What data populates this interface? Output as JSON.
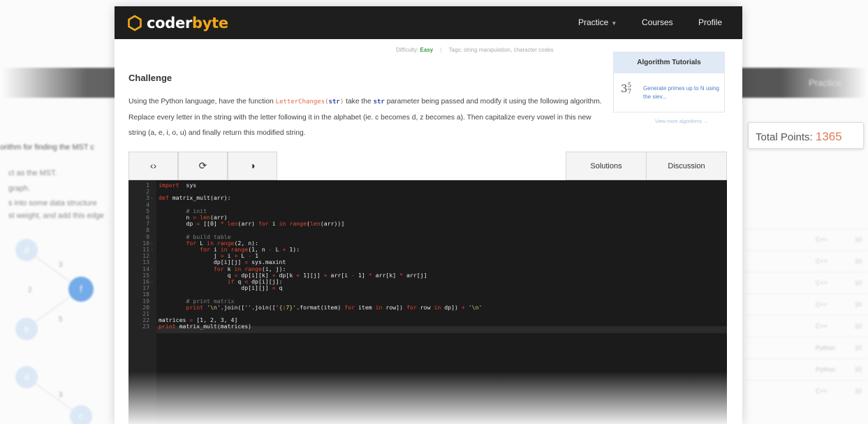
{
  "app": {
    "brand_prefix": "coder",
    "brand_suffix": "byte",
    "accent_color": "#f2a81d"
  },
  "nav": {
    "practice": "Practice",
    "courses": "Courses",
    "profile": "Profile"
  },
  "meta": {
    "difficulty_label": "Difficulty:",
    "difficulty_value": "Easy",
    "tags_label": "Tags:",
    "tags_value": "string manipulation, character codes"
  },
  "challenge": {
    "title": "Challenge",
    "text_1": "Using the Python language, have the function ",
    "function_name": "LetterChanges",
    "function_open": "(",
    "function_arg": "str",
    "function_close": ")",
    "text_2": " take the ",
    "param": "str",
    "text_3": " parameter being passed and modify it using the following algorithm. Replace every letter in the string with the letter following it in the alphabet (ie. c becomes d, z becomes a). Then capitalize every vowel in this new string (a, e, i, o, u) and finally return this modified string."
  },
  "tutorials": {
    "heading": "Algorithm Tutorials",
    "icon_text": "3",
    "icon_num": "5",
    "icon_den": "7",
    "link": "Generate primes up to N using the siev...",
    "view_more": "View more algorithms →"
  },
  "editor_toolbar": {
    "icons": [
      "code-icon",
      "refresh-icon",
      "contrast-icon"
    ],
    "glyphs": [
      "‹›",
      "⟳",
      "◑"
    ]
  },
  "editor_tabs": {
    "solutions": "Solutions",
    "discussion": "Discussion"
  },
  "code": [
    {
      "n": "1",
      "f": "",
      "t": [
        [
          "kw",
          "import"
        ],
        [
          "",
          "  sys"
        ]
      ]
    },
    {
      "n": "2",
      "f": "",
      "t": []
    },
    {
      "n": "3",
      "f": "-",
      "t": [
        [
          "kw",
          "def"
        ],
        [
          "",
          " matrix_mult(arr):"
        ]
      ]
    },
    {
      "n": "4",
      "f": "",
      "t": []
    },
    {
      "n": "5",
      "f": "",
      "t": [
        [
          "",
          "        "
        ],
        [
          "cm",
          "# init"
        ]
      ]
    },
    {
      "n": "6",
      "f": "",
      "t": [
        [
          "",
          "        n "
        ],
        [
          "kw",
          "="
        ],
        [
          "",
          " "
        ],
        [
          "kw",
          "len"
        ],
        [
          "",
          "(arr)"
        ]
      ]
    },
    {
      "n": "7",
      "f": "",
      "t": [
        [
          "",
          "        dp "
        ],
        [
          "kw",
          "="
        ],
        [
          "",
          " [[0] "
        ],
        [
          "kw",
          "*"
        ],
        [
          "",
          " "
        ],
        [
          "kw",
          "len"
        ],
        [
          "",
          "(arr) "
        ],
        [
          "kw",
          "for"
        ],
        [
          "",
          " i "
        ],
        [
          "kw",
          "in"
        ],
        [
          "",
          " "
        ],
        [
          "kw",
          "range"
        ],
        [
          "",
          "("
        ],
        [
          "kw",
          "len"
        ],
        [
          "",
          "(arr))]"
        ]
      ]
    },
    {
      "n": "8",
      "f": "",
      "t": []
    },
    {
      "n": "9",
      "f": "",
      "t": [
        [
          "",
          "        "
        ],
        [
          "cm",
          "# build table"
        ]
      ]
    },
    {
      "n": "10",
      "f": "-",
      "t": [
        [
          "",
          "        "
        ],
        [
          "kw",
          "for"
        ],
        [
          "",
          " L "
        ],
        [
          "kw",
          "in"
        ],
        [
          "",
          " "
        ],
        [
          "kw",
          "range"
        ],
        [
          "",
          "(2, n):"
        ]
      ]
    },
    {
      "n": "11",
      "f": "-",
      "t": [
        [
          "",
          "            "
        ],
        [
          "kw",
          "for"
        ],
        [
          "",
          " i "
        ],
        [
          "kw",
          "in"
        ],
        [
          "",
          " "
        ],
        [
          "kw",
          "range"
        ],
        [
          "",
          "(1, n "
        ],
        [
          "kw",
          "-"
        ],
        [
          "",
          " L "
        ],
        [
          "kw",
          "+"
        ],
        [
          "",
          " 1):"
        ]
      ]
    },
    {
      "n": "12",
      "f": "",
      "t": [
        [
          "",
          "                j "
        ],
        [
          "kw",
          "="
        ],
        [
          "",
          " i "
        ],
        [
          "kw",
          "+"
        ],
        [
          "",
          " L "
        ],
        [
          "kw",
          "-"
        ],
        [
          "",
          " 1"
        ]
      ]
    },
    {
      "n": "13",
      "f": "",
      "t": [
        [
          "",
          "                dp[i][j] "
        ],
        [
          "kw",
          "="
        ],
        [
          "",
          " sys.maxint"
        ]
      ]
    },
    {
      "n": "14",
      "f": "-",
      "t": [
        [
          "",
          "                "
        ],
        [
          "kw",
          "for"
        ],
        [
          "",
          " k "
        ],
        [
          "kw",
          "in"
        ],
        [
          "",
          " "
        ],
        [
          "kw",
          "range"
        ],
        [
          "",
          "(i, j):"
        ]
      ]
    },
    {
      "n": "15",
      "f": "",
      "t": [
        [
          "",
          "                    q "
        ],
        [
          "kw",
          "="
        ],
        [
          "",
          " dp[i][k] "
        ],
        [
          "kw",
          "+"
        ],
        [
          "",
          " dp[k "
        ],
        [
          "kw",
          "+"
        ],
        [
          "",
          " 1][j] "
        ],
        [
          "kw",
          "+"
        ],
        [
          "",
          " arr[i "
        ],
        [
          "kw",
          "-"
        ],
        [
          "",
          " 1] "
        ],
        [
          "kw",
          "*"
        ],
        [
          "",
          " arr[k] "
        ],
        [
          "kw",
          "*"
        ],
        [
          "",
          " arr[j]"
        ]
      ]
    },
    {
      "n": "16",
      "f": "-",
      "t": [
        [
          "",
          "                    "
        ],
        [
          "kw",
          "if"
        ],
        [
          "",
          " q "
        ],
        [
          "kw",
          "<"
        ],
        [
          "",
          " dp[i][j]:"
        ]
      ]
    },
    {
      "n": "17",
      "f": "",
      "t": [
        [
          "",
          "                        dp[i][j] "
        ],
        [
          "kw",
          "="
        ],
        [
          "",
          " q"
        ]
      ]
    },
    {
      "n": "18",
      "f": "",
      "t": []
    },
    {
      "n": "19",
      "f": "",
      "t": [
        [
          "",
          "        "
        ],
        [
          "cm",
          "# print matrix"
        ]
      ]
    },
    {
      "n": "20",
      "f": "",
      "t": [
        [
          "",
          "        "
        ],
        [
          "kw",
          "print"
        ],
        [
          "",
          " "
        ],
        [
          "st",
          "'\\n'"
        ],
        [
          "",
          ".join(["
        ],
        [
          "st",
          "''"
        ],
        [
          "",
          ".join(["
        ],
        [
          "st",
          "'{:7}'"
        ],
        [
          "",
          ".format(item) "
        ],
        [
          "kw",
          "for"
        ],
        [
          "",
          " item "
        ],
        [
          "kw",
          "in"
        ],
        [
          "",
          " row]) "
        ],
        [
          "kw",
          "for"
        ],
        [
          "",
          " row "
        ],
        [
          "kw",
          "in"
        ],
        [
          "",
          " dp]) "
        ],
        [
          "kw",
          "+"
        ],
        [
          "",
          " "
        ],
        [
          "st",
          "'\\n'"
        ]
      ]
    },
    {
      "n": "21",
      "f": "",
      "t": []
    },
    {
      "n": "22",
      "f": "",
      "t": [
        [
          "",
          "matrices "
        ],
        [
          "kw",
          "="
        ],
        [
          "",
          " [1, 2, 3, 4]"
        ]
      ]
    },
    {
      "n": "23",
      "f": "",
      "t": [
        [
          "kw",
          "print"
        ],
        [
          "",
          " matrix_mult(matrices)"
        ]
      ]
    }
  ],
  "background": {
    "practice": "Practice",
    "line_1": "orithm for finding the MST c",
    "line_2": "ct as the MST.",
    "line_3": "graph.",
    "line_4": "s into some data structure",
    "line_5": "st weight, and add this edge",
    "total_points_label": "Total Points:",
    "total_points_value": "1365",
    "nodes": [
      "d",
      "f",
      "e",
      "d",
      "c"
    ],
    "edge_labels": [
      "3",
      "2",
      "5",
      "3"
    ],
    "table_rows": [
      {
        "lang": "C++",
        "score": "10"
      },
      {
        "lang": "C++",
        "score": "10"
      },
      {
        "lang": "C++",
        "score": "10"
      },
      {
        "lang": "C++",
        "score": "10"
      },
      {
        "lang": "C++",
        "score": "10"
      },
      {
        "lang": "Python",
        "score": "10"
      },
      {
        "lang": "Python",
        "score": "10"
      },
      {
        "lang": "C++",
        "score": "10"
      }
    ]
  }
}
